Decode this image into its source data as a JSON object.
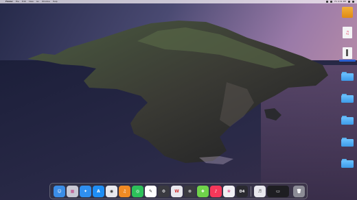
{
  "menubar": {
    "apple": "",
    "app": "Finder",
    "items": [
      "File",
      "Edit",
      "View",
      "Go",
      "Window",
      "Help"
    ],
    "clock": "Fri 4:31 PM"
  },
  "desktop_icons": [
    {
      "name": "drive-icon",
      "label": "",
      "kind": "drive"
    },
    {
      "name": "music-file-icon",
      "label": "",
      "kind": "audio"
    },
    {
      "name": "document-icon",
      "label": "",
      "kind": "doc",
      "selected": true
    },
    {
      "name": "folder-1-icon",
      "label": "",
      "kind": "folder"
    },
    {
      "name": "folder-2-icon",
      "label": "",
      "kind": "folder"
    },
    {
      "name": "folder-3-icon",
      "label": "",
      "kind": "folder"
    },
    {
      "name": "folder-4-icon",
      "label": "",
      "kind": "folder"
    },
    {
      "name": "folder-5-icon",
      "label": "",
      "kind": "folder"
    }
  ],
  "dock": [
    {
      "name": "finder-icon",
      "glyph": "☺",
      "color": "#3b8de6"
    },
    {
      "name": "launchpad-icon",
      "glyph": "▦",
      "color": "#d0d0d8"
    },
    {
      "name": "safari-icon",
      "glyph": "✦",
      "color": "#2f8ff0"
    },
    {
      "name": "app-store-icon",
      "glyph": "A",
      "color": "#1f8ef5"
    },
    {
      "name": "system-monitor-icon",
      "glyph": "◉",
      "color": "#e8e8ee"
    },
    {
      "name": "music-app-icon",
      "glyph": "♫",
      "color": "#f08a24"
    },
    {
      "name": "wechat-icon",
      "glyph": "◎",
      "color": "#2dc05a"
    },
    {
      "name": "scrub-app-icon",
      "glyph": "✎",
      "color": "#ffffff"
    },
    {
      "name": "settings-icon",
      "glyph": "⚙",
      "color": "#8a8a92"
    },
    {
      "name": "xcode-icon",
      "glyph": "❖",
      "color": "#6fd24a"
    },
    {
      "name": "wps-icon",
      "glyph": "W",
      "color": "#e8e8ee"
    },
    {
      "name": "itunes-icon",
      "glyph": "♪",
      "color": "#f5385a"
    },
    {
      "name": "photos-icon",
      "glyph": "❀",
      "color": "#f0f0f4"
    },
    {
      "name": "d4-app-icon",
      "glyph": "D4",
      "color": "#2a2a30"
    },
    {
      "name": "text-edit-icon",
      "glyph": "♬",
      "color": "#e8e8ee"
    },
    {
      "name": "screenshot-icon",
      "glyph": "▭",
      "color": "#1e1e22"
    },
    {
      "name": "trash-icon",
      "glyph": "🗑",
      "color": "#8c8c96"
    }
  ]
}
